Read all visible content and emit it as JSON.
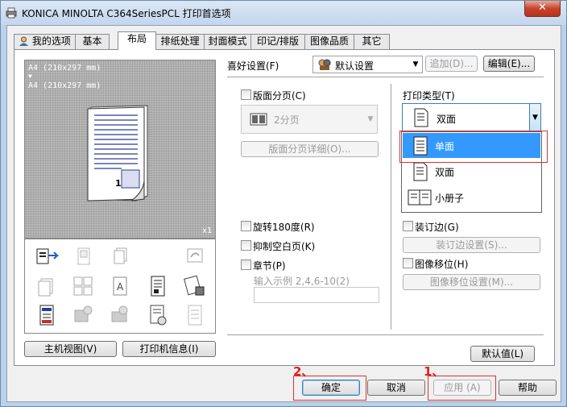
{
  "window": {
    "title": "KONICA MINOLTA C364SeriesPCL 打印首选项",
    "close_label": "✕"
  },
  "tabs": [
    {
      "label": "我的选项",
      "active": false
    },
    {
      "label": "基本",
      "active": false
    },
    {
      "label": "布局",
      "active": true
    },
    {
      "label": "排纸处理",
      "active": false
    },
    {
      "label": "封面模式",
      "active": false
    },
    {
      "label": "印记/排版",
      "active": false
    },
    {
      "label": "图像品质",
      "active": false
    },
    {
      "label": "其它",
      "active": false
    }
  ],
  "preview": {
    "paper_line1": "A4 (210x297 mm)",
    "arrow": "▼",
    "paper_line2": "A4 (210x297 mm)",
    "copies": "x1",
    "page_number": "1"
  },
  "left_buttons": {
    "main_view": "主机视图(V)",
    "printer_info": "打印机信息(I)"
  },
  "favorites": {
    "label": "喜好设置(F)",
    "value": "默认设置",
    "add": "追加(D)...",
    "edit": "编辑(E)..."
  },
  "layout": {
    "combine_label": "版面分页(C)",
    "combine_value": "2分页",
    "combine_details": "版面分页详细(O)...",
    "rotate_label": "旋转180度(R)",
    "skip_blank_label": "抑制空白页(K)",
    "chapter_label": "章节(P)",
    "chapter_example": "输入示例 2,4,6-10(2)",
    "chapter_value": ""
  },
  "print_type": {
    "label": "打印类型(T)",
    "current": "双面",
    "options": [
      "单面",
      "双面",
      "小册子"
    ],
    "highlighted": "单面"
  },
  "binding": {
    "margin_label": "装订边(G)",
    "margin_settings": "装订边设置(S)...",
    "shift_label": "图像移位(H)",
    "shift_settings": "图像移位设置(M)..."
  },
  "defaults_button": "默认值(L)",
  "footer": {
    "ok": "确定",
    "cancel": "取消",
    "apply": "应用 (A)",
    "help": "帮助"
  },
  "annotations": {
    "step1": "1、",
    "step2": "2、"
  },
  "colors": {
    "highlight": "#3399ff",
    "annotation_red": "#e03030",
    "ok_focus": "#3c7fb1"
  }
}
